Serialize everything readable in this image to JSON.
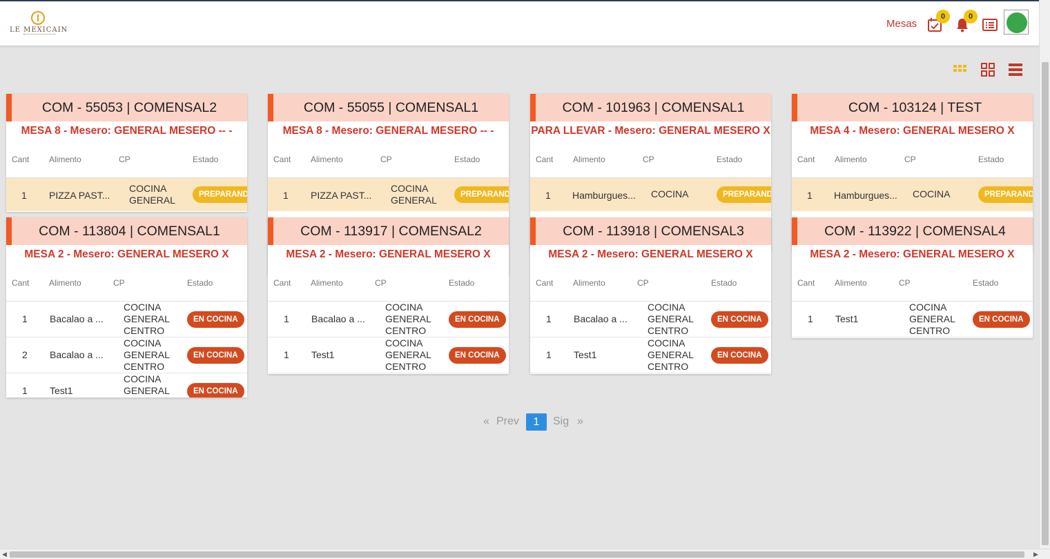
{
  "brand": {
    "name": "LE MEXICAIN"
  },
  "header": {
    "mesas_label": "Mesas",
    "tasks_badge": "0",
    "notifications_badge": "0"
  },
  "colors": {
    "accent": "#f15a24",
    "header_bg": "#fad3c6",
    "subtitle": "#d1372a",
    "preparando": "#f0b820",
    "en_cocina": "#d34a1f",
    "page_active": "#2d8ee0"
  },
  "columns": {
    "cant": "Cant",
    "alimento": "Alimento",
    "cp": "CP",
    "estado": "Estado"
  },
  "cards": [
    {
      "title": "COM - 55053 | COMENSAL2",
      "subtitle": "MESA 8 - Mesero: GENERAL MESERO -- -",
      "items": [
        {
          "cant": "1",
          "alimento": "PIZZA PAST...",
          "cp": [
            "COCINA",
            "GENERAL"
          ],
          "estado": "PREPARANDO"
        }
      ]
    },
    {
      "title": "COM - 55055 | COMENSAL1",
      "subtitle": "MESA 8 - Mesero: GENERAL MESERO -- -",
      "items": [
        {
          "cant": "1",
          "alimento": "PIZZA PAST...",
          "cp": [
            "COCINA",
            "GENERAL"
          ],
          "estado": "PREPARANDO"
        }
      ]
    },
    {
      "title": "COM - 101963 | COMENSAL1",
      "subtitle": "PARA LLEVAR - Mesero: GENERAL MESERO X",
      "items": [
        {
          "cant": "1",
          "alimento": "Hamburgues...",
          "cp": [
            "COCINA"
          ],
          "estado": "PREPARANDO"
        }
      ]
    },
    {
      "title": "COM - 103124 | TEST",
      "subtitle": "MESA 4 - Mesero: GENERAL MESERO X",
      "items": [
        {
          "cant": "1",
          "alimento": "Hamburgues...",
          "cp": [
            "COCINA"
          ],
          "estado": "PREPARANDO"
        }
      ]
    },
    {
      "title": "COM - 113804 | COMENSAL1",
      "subtitle": "MESA 2 - Mesero: GENERAL MESERO X",
      "items": [
        {
          "cant": "1",
          "alimento": "Bacalao a ...",
          "cp": [
            "COCINA",
            "GENERAL",
            "CENTRO"
          ],
          "estado": "EN COCINA"
        },
        {
          "cant": "2",
          "alimento": "Bacalao a ...",
          "cp": [
            "COCINA",
            "GENERAL",
            "CENTRO"
          ],
          "estado": "EN COCINA"
        },
        {
          "cant": "1",
          "alimento": "Test1",
          "cp": [
            "COCINA",
            "GENERAL"
          ],
          "estado": "EN COCINA"
        }
      ]
    },
    {
      "title": "COM - 113917 | COMENSAL2",
      "subtitle": "MESA 2 - Mesero: GENERAL MESERO X",
      "items": [
        {
          "cant": "1",
          "alimento": "Bacalao a ...",
          "cp": [
            "COCINA",
            "GENERAL",
            "CENTRO"
          ],
          "estado": "EN COCINA"
        },
        {
          "cant": "1",
          "alimento": "Test1",
          "cp": [
            "COCINA",
            "GENERAL",
            "CENTRO"
          ],
          "estado": "EN COCINA"
        }
      ]
    },
    {
      "title": "COM - 113918 | COMENSAL3",
      "subtitle": "MESA 2 - Mesero: GENERAL MESERO X",
      "items": [
        {
          "cant": "1",
          "alimento": "Bacalao a ...",
          "cp": [
            "COCINA",
            "GENERAL",
            "CENTRO"
          ],
          "estado": "EN COCINA"
        },
        {
          "cant": "1",
          "alimento": "Test1",
          "cp": [
            "COCINA",
            "GENERAL",
            "CENTRO"
          ],
          "estado": "EN COCINA"
        }
      ]
    },
    {
      "title": "COM - 113922 | COMENSAL4",
      "subtitle": "MESA 2 - Mesero: GENERAL MESERO X",
      "items": [
        {
          "cant": "1",
          "alimento": "Test1",
          "cp": [
            "COCINA",
            "GENERAL",
            "CENTRO"
          ],
          "estado": "EN COCINA"
        }
      ]
    }
  ],
  "pagination": {
    "first": "«",
    "prev": "Prev",
    "current": "1",
    "next": "Sig",
    "last": "»"
  },
  "icons": {
    "tasks": "calendar-check-icon",
    "notifications": "bell-icon",
    "orders": "list-icon",
    "view_small_grid": "small-grid-icon",
    "view_large_grid": "large-grid-icon",
    "view_list": "list-view-icon"
  }
}
